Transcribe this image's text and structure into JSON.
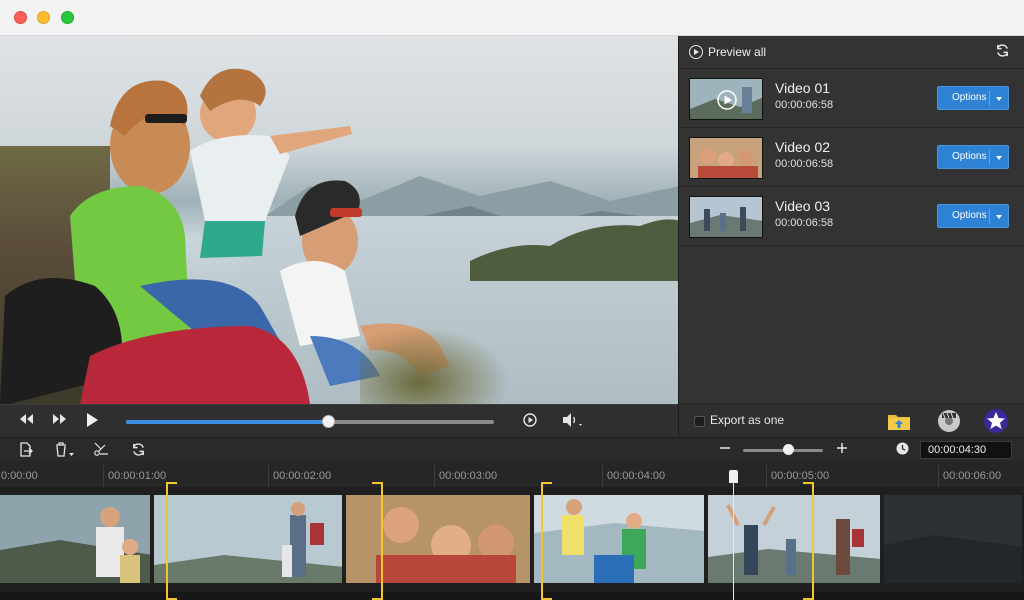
{
  "window": {
    "title": ""
  },
  "player": {
    "progress": 0.55,
    "controls": [
      "rewind-icon",
      "fast-forward-icon",
      "play-icon",
      "snapshot-icon",
      "volume-icon"
    ]
  },
  "panel": {
    "preview_all_label": "Preview all",
    "videos": [
      {
        "title": "Video 01",
        "duration": "00:00:06:58",
        "options_label": "Options"
      },
      {
        "title": "Video 02",
        "duration": "00:00:06:58",
        "options_label": "Options"
      },
      {
        "title": "Video 03",
        "duration": "00:00:06:58",
        "options_label": "Options"
      }
    ],
    "export_label": "Export as one",
    "export_checked": false
  },
  "timeline": {
    "current_time": "00:00:04:30",
    "zoom_level": 0.56,
    "ruler_labels": [
      "0:00:00",
      "00:00:01:00",
      "00:00:02:00",
      "00:00:03:00",
      "00:00:04:00",
      "00:00:05:00",
      "00:00:06:00"
    ]
  },
  "colors": {
    "accent": "#2e82d6",
    "trim": "#f2c72b",
    "panel": "#333333"
  }
}
